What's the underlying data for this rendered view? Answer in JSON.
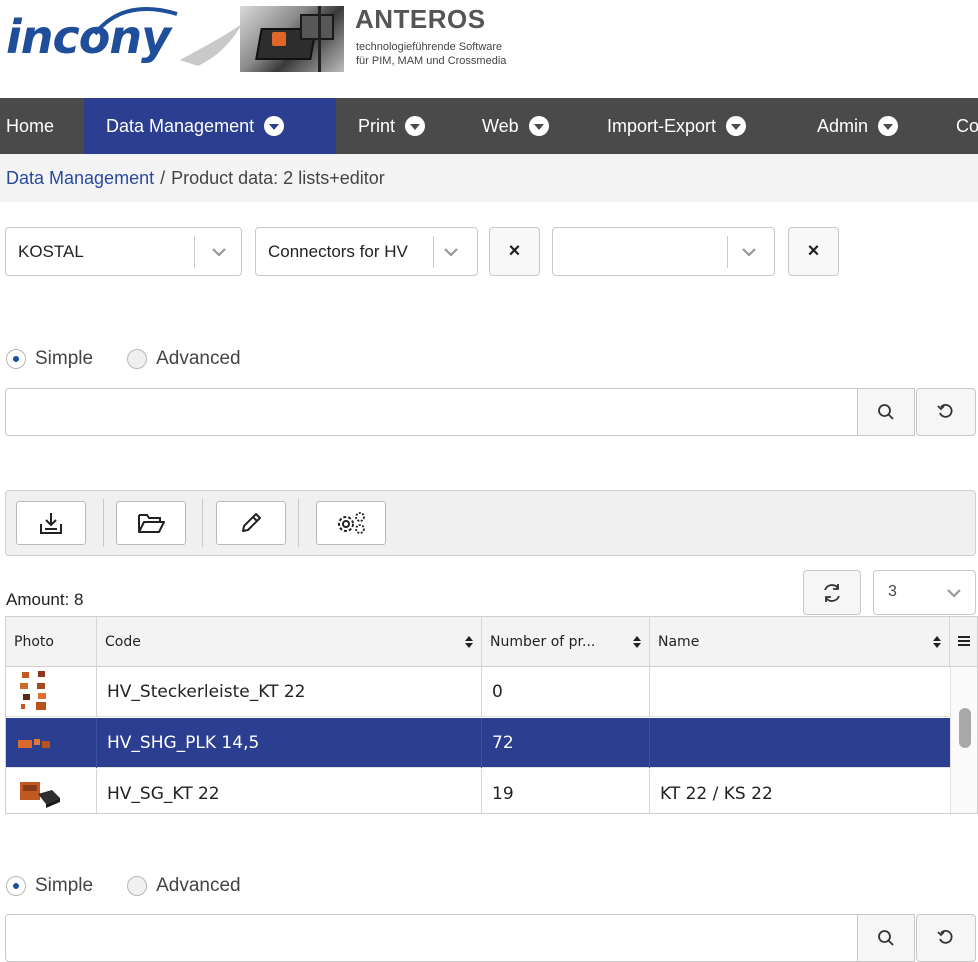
{
  "header": {
    "logo_text": "incony",
    "product_title": "ANTEROS",
    "product_sub1": "technologieführende Software",
    "product_sub2": "für PIM, MAM und Crossmedia"
  },
  "nav": {
    "items": [
      {
        "label": "Home",
        "dropdown": false
      },
      {
        "label": "Data Management",
        "dropdown": true,
        "active": true
      },
      {
        "label": "Print",
        "dropdown": true
      },
      {
        "label": "Web",
        "dropdown": true
      },
      {
        "label": "Import-Export",
        "dropdown": true
      },
      {
        "label": "Admin",
        "dropdown": true
      },
      {
        "label": "Co",
        "dropdown": false
      }
    ]
  },
  "breadcrumb": {
    "root": "Data Management",
    "separator": "/",
    "current": "Product data: 2 lists+editor"
  },
  "filters": {
    "select1_value": "KOSTAL",
    "select2_value": "Connectors for HV",
    "select3_value": "",
    "clear_label": "×"
  },
  "search1": {
    "simple_label": "Simple",
    "advanced_label": "Advanced",
    "mode": "Simple",
    "query": ""
  },
  "toolbar": {
    "buttons": [
      "download-icon",
      "folder-open-icon",
      "edit-pencil-icon",
      "settings-gears-icon"
    ]
  },
  "list": {
    "amount_label": "Amount: 8",
    "page_size": "3",
    "columns": [
      "Photo",
      "Code",
      "Number of pr...",
      "Name"
    ],
    "rows": [
      {
        "code": "HV_Steckerleiste_KT 22",
        "number": "0",
        "name": "",
        "selected": false
      },
      {
        "code": "HV_SHG_PLK 14,5",
        "number": "72",
        "name": "",
        "selected": true
      },
      {
        "code": "HV_SG_KT 22",
        "number": "19",
        "name": "KT 22 / KS 22",
        "selected": false
      }
    ],
    "scroll_position": 0.28
  },
  "search2": {
    "simple_label": "Simple",
    "advanced_label": "Advanced",
    "mode": "Simple",
    "query": ""
  },
  "colors": {
    "nav_bg": "#4a4a4a",
    "accent": "#2c3e8f",
    "logo": "#1f4e9b"
  }
}
